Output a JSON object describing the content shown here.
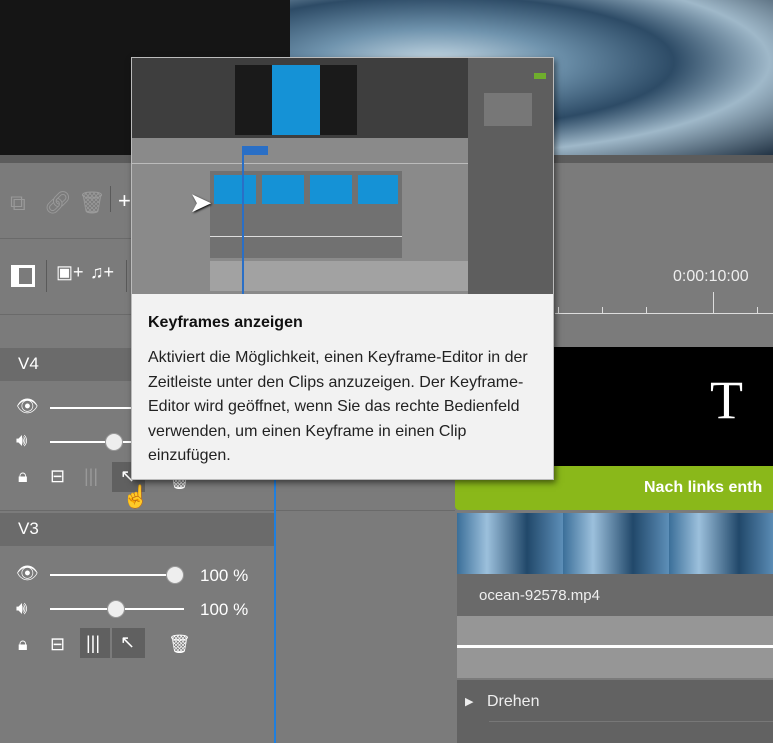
{
  "toolbar": {
    "icons": [
      "copy-icon",
      "link-icon",
      "trash-icon",
      "plus-icon"
    ]
  },
  "toolbar2": {
    "icons": [
      "panel-icon",
      "add-video-track-icon",
      "add-audio-track-icon"
    ]
  },
  "tracks": [
    {
      "name": "V4",
      "opacity": "",
      "volume": ""
    },
    {
      "name": "V3",
      "opacity_label": "100 %",
      "volume_label": "100 %",
      "opacity": 1.0,
      "volume": 0.5
    }
  ],
  "timeline": {
    "ruler_time": "0:00:10:00",
    "title_clip_glyph": "T",
    "effect_label": "Nach links enth",
    "clip_filename": "ocean-92578.mp4",
    "property_section": "Drehen"
  },
  "tooltip": {
    "title": "Keyframes anzeigen",
    "body": "Aktiviert die Möglichkeit, einen Keyframe-Editor in der Zeitleiste unter den Clips anzuzeigen. Der Keyframe-Editor wird geöffnet, wenn Sie das rechte Bedienfeld verwenden, um einen Keyframe in einen Clip einzufügen."
  },
  "colors": {
    "accent": "#1e7fe0",
    "effect_green": "#8ab81a",
    "clip_blue": "#1592d6"
  }
}
